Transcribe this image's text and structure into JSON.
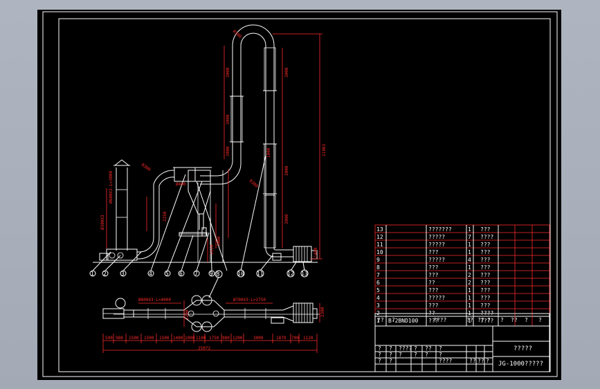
{
  "drawing": {
    "dims": {
      "top_bend": "R300",
      "tube_up1": "3000",
      "tube_up2": "3000",
      "tube_up3": "3000",
      "tube_down1": "3000",
      "tube_down2": "3000",
      "tube_down3": "3000",
      "total_height": "21963",
      "left_pipe_label": "Ø300X3",
      "left_bend": "R300",
      "dust_pipe": "Ø600X3-L=3000",
      "inlet": "Ø400",
      "mid_pipe": "2250",
      "right_small": "R300",
      "height_2310": "2310",
      "low_1000": "1000",
      "top_1000": "1000",
      "fan_1400": "1400"
    },
    "part_numbers": [
      "1",
      "2",
      "3",
      "4",
      "5",
      "6",
      "7",
      "8",
      "9",
      "10",
      "11",
      "12",
      "13"
    ],
    "plan_view": {
      "label_left": "Ø800X3-L=4000",
      "label_right": "Ø700X3-L=2750",
      "balloon_8": "8",
      "height_right": "2300",
      "height_mid": "2200",
      "total": "25072",
      "segments": [
        "590",
        "980",
        "1500",
        "1500",
        "1500",
        "1400",
        "1000",
        "1100",
        "1750",
        "980",
        "1200",
        "3000",
        "1870",
        "700",
        "1120"
      ]
    }
  },
  "bom": {
    "rows": [
      {
        "no": "13",
        "name": "???????",
        "qty": "1",
        "mat": "???"
      },
      {
        "no": "12",
        "name": "?????",
        "qty": "7",
        "mat": "????"
      },
      {
        "no": "11",
        "name": "?????",
        "qty": "1",
        "mat": "???"
      },
      {
        "no": "10",
        "name": "???",
        "qty": "1",
        "mat": "???"
      },
      {
        "no": "9",
        "name": "?????",
        "qty": "4",
        "mat": "???"
      },
      {
        "no": "8",
        "name": "???",
        "qty": "1",
        "mat": "???"
      },
      {
        "no": "7",
        "name": "???",
        "qty": "2",
        "mat": "???"
      },
      {
        "no": "6",
        "name": "??",
        "qty": "2",
        "mat": "???"
      },
      {
        "no": "5",
        "name": "???",
        "qty": "1",
        "mat": "???"
      },
      {
        "no": "4",
        "name": "?????",
        "qty": "1",
        "mat": "???"
      },
      {
        "no": "3",
        "name": "???",
        "qty": "1",
        "mat": "???"
      },
      {
        "no": "2",
        "name": "??",
        "qty": "1",
        "mat": "????"
      },
      {
        "no": "1",
        "code": "B-2BND100",
        "name": "???",
        "qty": "1",
        "mat": "????"
      }
    ],
    "header": [
      "??",
      "?",
      "????",
      "??",
      "??",
      "?",
      "?",
      "??",
      "?",
      "?"
    ]
  },
  "title_block": {
    "title": "?????",
    "drawing_no": "JG-1000?????",
    "grid_row1": [
      "?",
      "?",
      "????",
      "?",
      "??",
      "?"
    ],
    "grid_row2": [
      "?",
      "?",
      "?",
      "?",
      "?",
      "?"
    ],
    "grid_row3": [
      "?",
      "?",
      "????",
      "??",
      "??",
      "?"
    ]
  }
}
